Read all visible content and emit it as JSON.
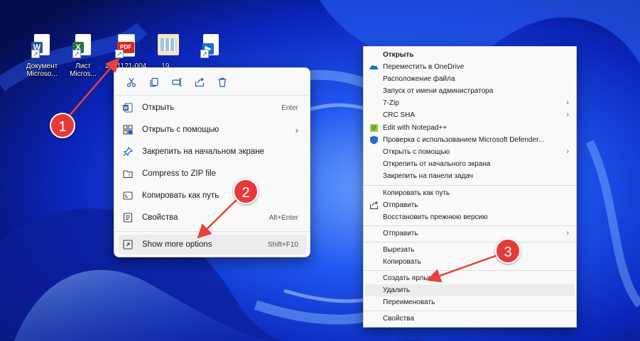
{
  "desktop": {
    "icons": [
      {
        "label": "Документ\nMicroso...",
        "icon": "word-document-icon",
        "tag": "W"
      },
      {
        "label": "Лист\nMicros...",
        "icon": "excel-sheet-icon",
        "tag": "X"
      },
      {
        "label": "20211?1-004",
        "icon": "pdf-file-icon",
        "tag": "PDF"
      },
      {
        "label": "19...",
        "icon": "image-file-icon",
        "tag": ""
      },
      {
        "label": "...",
        "icon": "video-file-icon",
        "tag": ""
      }
    ]
  },
  "win11_menu": {
    "toolbar": [
      "cut-icon",
      "copy-icon",
      "rename-icon",
      "share-icon",
      "delete-icon"
    ],
    "items": [
      {
        "label": "Открыть",
        "shortcut": "Enter",
        "icon": "word-icon"
      },
      {
        "label": "Открыть с помощью",
        "shortcut": "",
        "icon": "open-with-icon",
        "submenu": true
      },
      {
        "label": "Закрепить на начальном экране",
        "shortcut": "",
        "icon": "pin-icon"
      },
      {
        "label": "Compress to ZIP file",
        "shortcut": "",
        "icon": "zip-folder-icon"
      },
      {
        "label": "Копировать как путь",
        "shortcut": "",
        "icon": "copy-path-icon"
      },
      {
        "label": "Свойства",
        "shortcut": "Alt+Enter",
        "icon": "properties-icon"
      },
      {
        "label": "Show more options",
        "shortcut": "Shift+F10",
        "icon": "more-options-icon"
      }
    ]
  },
  "classic_menu": {
    "items": [
      {
        "label": "Открыть",
        "bold": true
      },
      {
        "label": "Переместить в OneDrive",
        "icon": "onedrive-icon"
      },
      {
        "label": "Расположение файла"
      },
      {
        "label": "Запуск от имени администратора"
      },
      {
        "label": "7-Zip",
        "submenu": true
      },
      {
        "label": "CRC SHA",
        "submenu": true
      },
      {
        "label": "Edit with Notepad++",
        "icon": "notepad-plus-icon"
      },
      {
        "label": "Проверка с использованием Microsoft Defender...",
        "icon": "defender-shield-icon"
      },
      {
        "label": "Открыть с помощью",
        "submenu": true
      },
      {
        "label": "Открепить от начального экрана"
      },
      {
        "label": "Закрепить на панели задач"
      },
      {
        "label": "Копировать как путь"
      },
      {
        "label": "Отправить",
        "icon": "share-icon"
      },
      {
        "label": "Восстановить прежнюю версию"
      },
      {
        "label": "Отправить",
        "submenu": true
      },
      {
        "label": "Вырезать"
      },
      {
        "label": "Копировать"
      },
      {
        "label": "Создать ярлык"
      },
      {
        "label": "Удалить"
      },
      {
        "label": "Переименовать"
      },
      {
        "label": "Свойства"
      }
    ]
  },
  "annotations": [
    {
      "number": "1"
    },
    {
      "number": "2"
    },
    {
      "number": "3"
    }
  ],
  "colors": {
    "badge": "#e63a3a",
    "arrow": "#e8403c",
    "wallpaper": "#0a2bd6"
  }
}
